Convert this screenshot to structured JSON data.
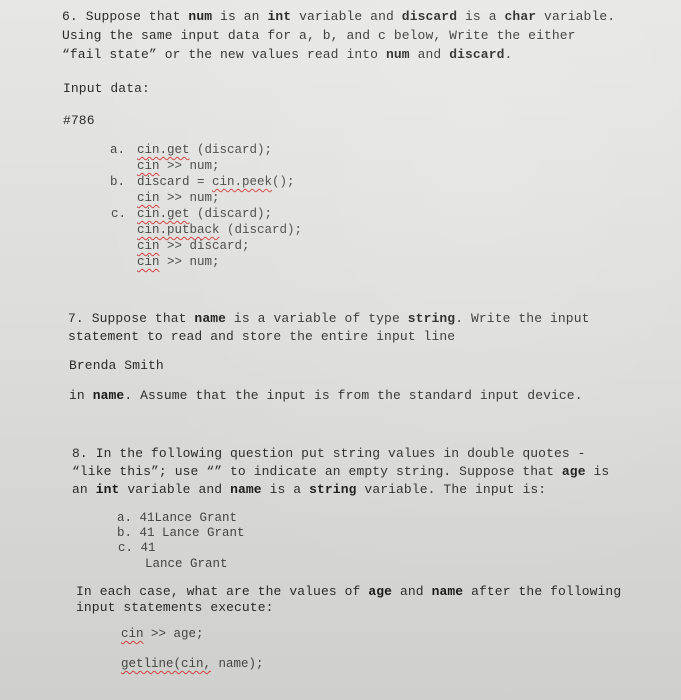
{
  "q6": {
    "line1": [
      "6. Suppose that ",
      "num",
      " is an ",
      "int",
      " variable and ",
      "discard",
      " is a ",
      "char",
      " variable."
    ],
    "line2": "Using the same input data for a, b, and c below, Write the either",
    "line3": [
      "“fail state” or the new values read into ",
      "num",
      " and ",
      "discard",
      "."
    ],
    "input_label": "Input data:",
    "input_value": "#786",
    "parts": [
      {
        "label": "a.",
        "lines": [
          [
            "cin.get",
            " (discard);"
          ],
          [
            "cin",
            " >> num;"
          ]
        ]
      },
      {
        "label": "b.",
        "lines": [
          [
            "discard = ",
            "cin.peek",
            "();"
          ],
          [
            "cin",
            " >> num;"
          ]
        ]
      },
      {
        "label": "c.",
        "lines": [
          [
            "cin.get",
            " (discard);"
          ],
          [
            "cin.putback",
            " (discard);"
          ],
          [
            "cin",
            " >> discard;"
          ],
          [
            "cin",
            " >> num;"
          ]
        ]
      }
    ]
  },
  "q7": {
    "line1": [
      "7. Suppose that ",
      "name",
      " is a variable of type ",
      "string",
      ". Write the input"
    ],
    "line2": "statement to read and store the entire input line",
    "example": "Brenda Smith",
    "line3": [
      "in ",
      "name",
      ". Assume that the input is from the standard input device."
    ]
  },
  "q8": {
    "line1": "8. In the following question put string values in double quotes -",
    "line2": [
      "“like this”; use “” to indicate an empty string. Suppose that ",
      "age",
      " is"
    ],
    "line3": [
      "an ",
      "int",
      " variable and ",
      "name",
      " is a ",
      "string",
      " variable. The input is:"
    ],
    "inputs": [
      {
        "label": "a.",
        "text": "41Lance Grant"
      },
      {
        "label": "b.",
        "text": "41 Lance Grant"
      },
      {
        "label": "c.",
        "text": "41"
      },
      {
        "label": "",
        "text": "Lance Grant"
      }
    ],
    "line4": [
      "In each case, what are the values of ",
      "age",
      " and ",
      "name",
      " after the following"
    ],
    "line5": "input statements execute:",
    "stmt1": [
      "cin",
      " >> age;"
    ],
    "stmt2": [
      "getline(cin,",
      " name);"
    ]
  }
}
